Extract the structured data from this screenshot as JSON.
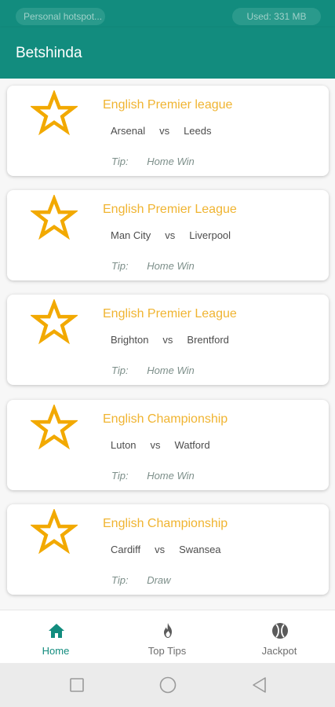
{
  "status_bar": {
    "left_pill": "Personal hotspot...",
    "right_pill": "Used: 331 MB"
  },
  "app": {
    "title": "Betshinda"
  },
  "colors": {
    "primary": "#128c7e",
    "league": "#f0b431",
    "star": "#f2a900"
  },
  "cards": [
    {
      "icon": "star-icon",
      "league": "English Premier league",
      "home": "Arsenal",
      "vs": "vs",
      "away": "Leeds",
      "tip_label": "Tip:",
      "tip": "Home Win"
    },
    {
      "icon": "star-icon",
      "league": "English Premier League",
      "home": "Man City",
      "vs": "vs",
      "away": "Liverpool",
      "tip_label": "Tip:",
      "tip": "Home Win"
    },
    {
      "icon": "star-icon",
      "league": "English Premier League",
      "home": "Brighton",
      "vs": "vs",
      "away": "Brentford",
      "tip_label": "Tip:",
      "tip": "Home Win"
    },
    {
      "icon": "star-icon",
      "league": "English Championship",
      "home": "Luton",
      "vs": "vs",
      "away": "Watford",
      "tip_label": "Tip:",
      "tip": "Home Win"
    },
    {
      "icon": "star-icon",
      "league": "English Championship",
      "home": "Cardiff",
      "vs": "vs",
      "away": "Swansea",
      "tip_label": "Tip:",
      "tip": "Draw"
    }
  ],
  "bottom_nav": {
    "items": [
      {
        "label": "Home",
        "icon": "home-icon",
        "active": true
      },
      {
        "label": "Top Tips",
        "icon": "flame-icon",
        "active": false
      },
      {
        "label": "Jackpot",
        "icon": "ball-icon",
        "active": false
      }
    ]
  },
  "system_nav": {
    "icons": [
      "recents-icon",
      "home-circle-icon",
      "back-icon"
    ]
  }
}
